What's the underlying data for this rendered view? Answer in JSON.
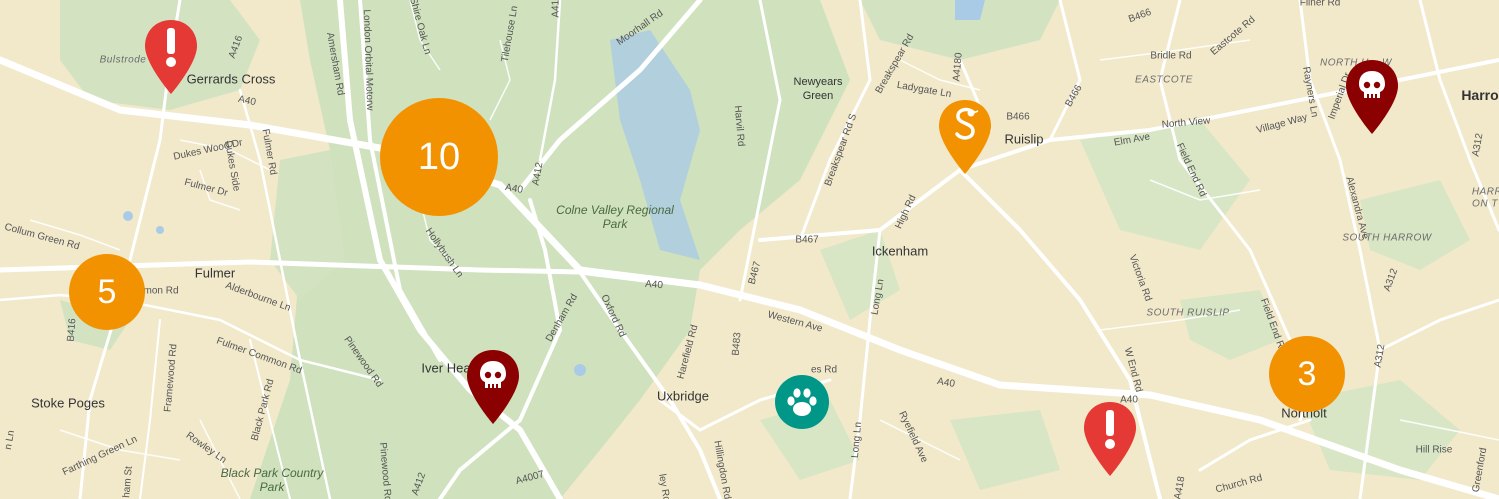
{
  "map": {
    "labels": {
      "bulstrode": "Bulstrode",
      "gerrards_cross": "Gerrards Cross",
      "fulmer": "Fulmer",
      "stoke_poges": "Stoke Poges",
      "iver_heath": "Iver Hea",
      "uxbridge": "Uxbridge",
      "ickenham": "Ickenham",
      "ruislip": "Ruislip",
      "newyears_green": "Newyears Green",
      "eastcote": "EASTCOTE",
      "south_ruislip": "SOUTH RUISLIP",
      "south_harrow": "SOUTH HARROW",
      "northolt": "Northolt",
      "harrow": "Harro",
      "north_harrow": "NORTH H    W",
      "harrow_partial": "HARR",
      "harrow_partial2": "ON T",
      "colne_valley": "Colne Valley Regional Park",
      "black_park": "Black Park Country Park"
    },
    "roads": {
      "a416": "A416",
      "a40_gc": "A40",
      "a40_mid": "A40",
      "a40_east": "A40",
      "a40_far": "A40",
      "a40_center": "A40",
      "a412": "A412",
      "a412_top": "A412",
      "a412_bot": "A412",
      "a4180": "A4180",
      "a4180_bot": "A418",
      "a312": "A312",
      "a312_b": "A312",
      "a312_c": "A312",
      "a4007": "A4007",
      "b466": "B466",
      "b466_b": "B466",
      "b466_c": "B466",
      "b467": "B467",
      "b467_b": "B467",
      "b483": "B483",
      "b416": "B416",
      "fulmer_rd": "Fulmer Rd",
      "dukes_wood": "Dukes Wood Dr",
      "fulmer_dr": "Fulmer Dr",
      "dukes_side": "Dukes Side",
      "collum_green": "Collum Green Rd",
      "mon_rd": "mon Rd",
      "alderbourne": "Alderbourne Ln",
      "fulmer_common": "Fulmer Common Rd",
      "framewood": "Framewood Rd",
      "pinewood_rd": "Pinewood Rd",
      "pinewood_rd2": "Pinewood Rd",
      "black_park_rd": "Black Park Rd",
      "farthing_green": "Farthing Green Ln",
      "rowley": "Rowley Ln",
      "bham_st": "ham St",
      "n_ln": "n Ln",
      "amersham": "Amersham Rd",
      "london_orbital": "London Orbital Motorw",
      "shire_oak": "Shire Oak Ln",
      "tilehouse": "Tilehouse Ln",
      "moorhall": "Moorhall Rd",
      "hollybush": "Hollybush Ln",
      "denham": "Denham Rd",
      "oxford": "Oxford Rd",
      "harvil": "Harvil Rd",
      "breakspear_s": "Breakspear Rd S",
      "breakspear": "Breakspear Rd",
      "ladygate": "Ladygate Ln",
      "high_rd": "High Rd",
      "long_ln": "Long Ln",
      "long_ln2": "Long Ln",
      "elm_ave": "Elm Ave",
      "north_view": "North View",
      "village_way": "Village Way",
      "bridle": "Bridle Rd",
      "eastcote_rd": "Eastcote Rd",
      "fiiner": "Fiiner Rd",
      "rayners": "Rayners Ln",
      "imperial": "Imperial Dr",
      "field_end": "Field End Rd",
      "field_end2": "Field End Rd",
      "alexandra": "Alexandra Ave",
      "victoria": "Victoria Rd",
      "w_end": "W End Rd",
      "church": "Church Rd",
      "hill_rise": "Hill Rise",
      "greenford": "Greenford",
      "hillingdon": "Hillingdon Rd",
      "harefield": "Harefield Rd",
      "ryefield": "Ryefield Ave",
      "western": "Western Ave",
      "es_rd": "es Rd",
      "ley_rd": "ley Rd"
    },
    "clusters": [
      {
        "name": "cluster-10",
        "count": "10"
      },
      {
        "name": "cluster-5",
        "count": "5"
      },
      {
        "name": "cluster-3",
        "count": "3"
      }
    ],
    "markers": [
      {
        "type": "alert",
        "color": "#e53935"
      },
      {
        "type": "skull",
        "color": "#8b0000"
      },
      {
        "type": "snake",
        "color": "#f39200"
      },
      {
        "type": "paw",
        "color": "#009688"
      }
    ],
    "colors": {
      "land": "#f2e9cb",
      "park": "#cfe1bd",
      "road": "#ffffff",
      "water": "#aacbe6",
      "cluster": "#f39200"
    }
  }
}
